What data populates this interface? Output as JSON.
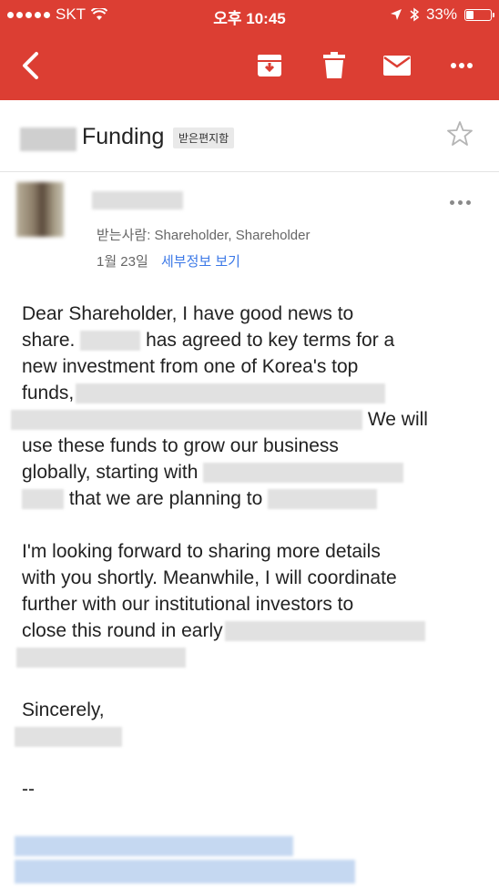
{
  "status": {
    "carrier": "SKT",
    "time": "오후 10:45",
    "battery": "33%",
    "battery_level": 0.33
  },
  "toolbar": {
    "back_icon": "back-arrow-icon",
    "archive_icon": "archive-icon",
    "delete_icon": "trash-icon",
    "mark_unread_icon": "mail-icon",
    "more_icon": "more-horizontal-icon"
  },
  "subject": {
    "text": "Funding",
    "label": "받은편지함"
  },
  "sender": {
    "recipients": "받는사람: Shareholder, Shareholder",
    "date": "1월 23일",
    "details_link": "세부정보 보기"
  },
  "body": {
    "l1": "Dear Shareholder, I have good news to",
    "l2a": "share.",
    "l2b": "has agreed to key terms for a",
    "l3": "new investment from one of Korea's top",
    "l4": "funds,",
    "l5": "We will",
    "l6": "use these funds to grow our business",
    "l7": "globally, starting with",
    "l8": "that we are planning to",
    "p2l1": "I'm looking forward to sharing more details",
    "p2l2": "with you shortly. Meanwhile, I will coordinate",
    "p2l3": "further with our institutional investors to",
    "p2l4": "close this round in early",
    "closing": "Sincerely,",
    "sig_sep": "--"
  },
  "colors": {
    "accent": "#dc3e33",
    "link": "#3b78e7"
  }
}
